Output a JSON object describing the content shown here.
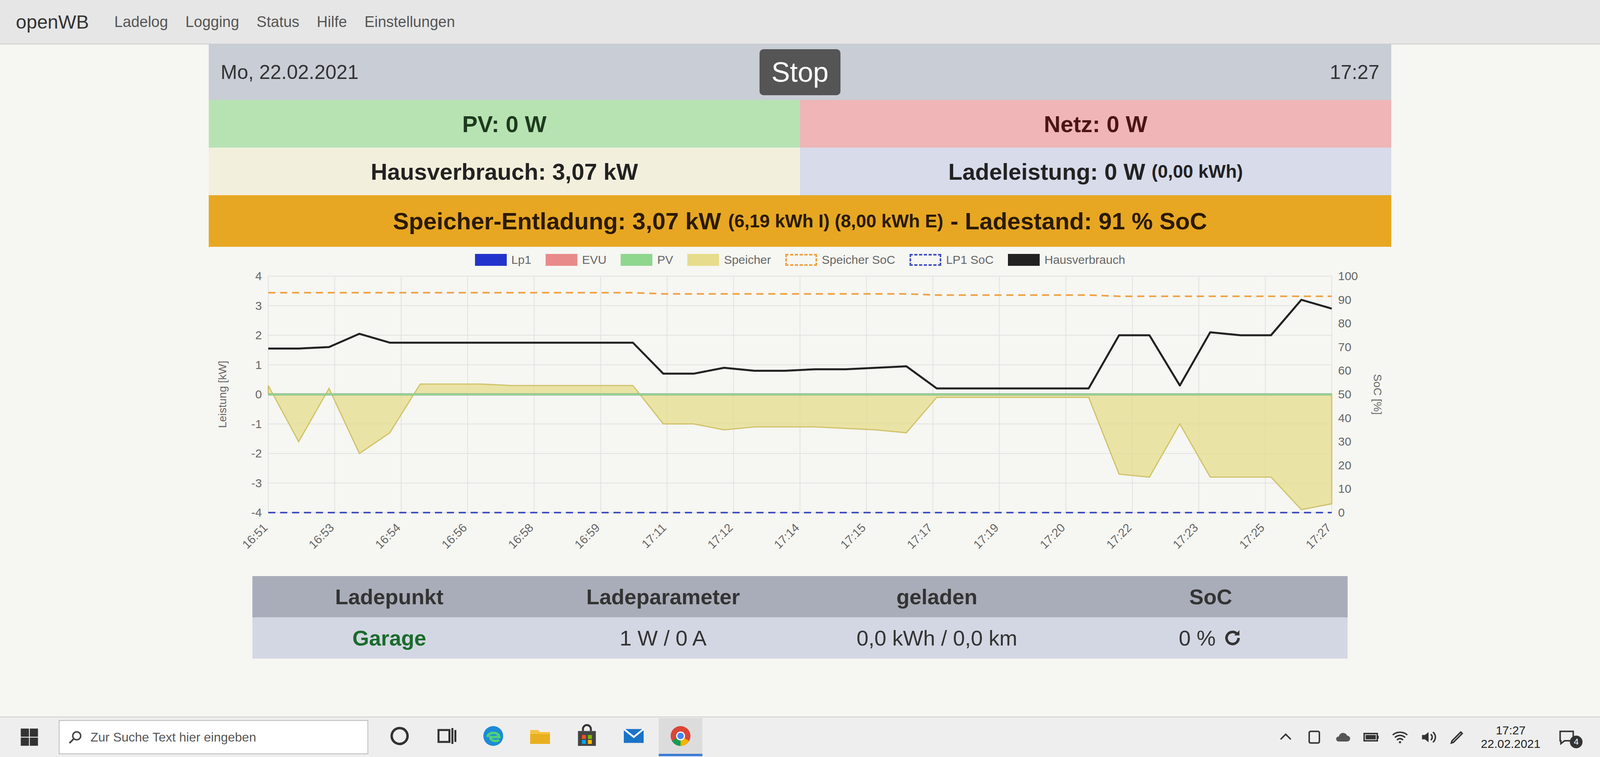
{
  "nav": {
    "brand": "openWB",
    "items": [
      "Ladelog",
      "Logging",
      "Status",
      "Hilfe",
      "Einstellungen"
    ]
  },
  "header": {
    "date": "Mo, 22.02.2021",
    "button": "Stop",
    "time": "17:27"
  },
  "tiles": {
    "pv": "PV: 0 W",
    "netz": "Netz: 0 W",
    "hausverbrauch": "Hausverbrauch: 3,07 kW",
    "ladeleistung": "Ladeleistung: 0 W",
    "ladeleistung_detail": "(0,00 kWh)"
  },
  "speicher": {
    "label": "Speicher-Entladung: 3,07 kW",
    "detail": "(6,19 kWh I) (8,00 kWh E)",
    "soc": "- Ladestand: 91 % SoC"
  },
  "chart": {
    "y_left": {
      "title": "Leistung [kW]",
      "ticks": [
        "4",
        "3",
        "2",
        "1",
        "0",
        "-1",
        "-2",
        "-3",
        "-4"
      ]
    },
    "y_right": {
      "title": "SoC [%]",
      "ticks": [
        "100",
        "90",
        "80",
        "70",
        "60",
        "50",
        "40",
        "30",
        "20",
        "10",
        "0"
      ]
    },
    "x_ticks": [
      "16:51",
      "16:53",
      "16:54",
      "16:56",
      "16:58",
      "16:59",
      "17:11",
      "17:12",
      "17:14",
      "17:15",
      "17:17",
      "17:19",
      "17:20",
      "17:22",
      "17:23",
      "17:25",
      "17:27"
    ],
    "series": [
      {
        "label": "Lp1",
        "color": "#2233cc",
        "kind": "line",
        "axis": "left",
        "values": [
          0,
          0,
          0,
          0,
          0,
          0,
          0,
          0,
          0,
          0,
          0,
          0,
          0,
          0,
          0,
          0,
          0,
          0,
          0,
          0,
          0,
          0,
          0,
          0,
          0,
          0,
          0,
          0,
          0,
          0,
          0,
          0,
          0,
          0,
          0,
          0
        ]
      },
      {
        "label": "EVU",
        "color": "#e88a8a",
        "kind": "line",
        "axis": "left",
        "values": [
          0,
          0,
          0,
          0,
          0,
          0,
          0,
          0,
          0,
          0,
          0,
          0,
          0,
          0,
          0,
          0,
          0,
          0,
          0,
          0,
          0,
          0,
          0,
          0,
          0,
          0,
          0,
          0,
          0,
          0,
          0,
          0,
          0,
          0,
          0,
          0
        ]
      },
      {
        "label": "PV",
        "color": "#8fd68f",
        "kind": "line",
        "axis": "left",
        "values": [
          0,
          0,
          0,
          0,
          0,
          0,
          0,
          0,
          0,
          0,
          0,
          0,
          0,
          0,
          0,
          0,
          0,
          0,
          0,
          0,
          0,
          0,
          0,
          0,
          0,
          0,
          0,
          0,
          0,
          0,
          0,
          0,
          0,
          0,
          0,
          0
        ]
      },
      {
        "label": "Speicher",
        "color": "#e6dc8c",
        "kind": "area",
        "axis": "left",
        "values": [
          0.3,
          -1.6,
          0.2,
          -2.0,
          -1.3,
          0.35,
          0.35,
          0.35,
          0.3,
          0.3,
          0.3,
          0.3,
          0.3,
          -1.0,
          -1.0,
          -1.2,
          -1.1,
          -1.1,
          -1.1,
          -1.15,
          -1.2,
          -1.3,
          -0.1,
          -0.1,
          -0.1,
          -0.1,
          -0.1,
          -0.1,
          -2.7,
          -2.8,
          -1.0,
          -2.8,
          -2.8,
          -2.8,
          -3.9,
          -3.7
        ]
      },
      {
        "label": "Speicher SoC",
        "color": "#f0a040",
        "kind": "dashed",
        "axis": "right",
        "values": [
          93,
          93,
          93,
          93,
          93,
          93,
          93,
          93,
          93,
          93,
          93,
          93,
          93,
          92.5,
          92.5,
          92.5,
          92.5,
          92.5,
          92.5,
          92.5,
          92.5,
          92.5,
          92,
          92,
          92,
          92,
          92,
          92,
          91.5,
          91.5,
          91.5,
          91.5,
          91.5,
          91.5,
          91.5,
          91.5
        ]
      },
      {
        "label": "LP1 SoC",
        "color": "#4050c0",
        "kind": "dashed",
        "axis": "right",
        "values": [
          0,
          0,
          0,
          0,
          0,
          0,
          0,
          0,
          0,
          0,
          0,
          0,
          0,
          0,
          0,
          0,
          0,
          0,
          0,
          0,
          0,
          0,
          0,
          0,
          0,
          0,
          0,
          0,
          0,
          0,
          0,
          0,
          0,
          0,
          0,
          0
        ]
      },
      {
        "label": "Hausverbrauch",
        "color": "#222222",
        "kind": "line",
        "axis": "left",
        "values": [
          1.55,
          1.55,
          1.6,
          2.05,
          1.75,
          1.75,
          1.75,
          1.75,
          1.75,
          1.75,
          1.75,
          1.75,
          1.75,
          0.7,
          0.7,
          0.9,
          0.8,
          0.8,
          0.85,
          0.85,
          0.9,
          0.95,
          0.2,
          0.2,
          0.2,
          0.2,
          0.2,
          0.2,
          2.0,
          2.0,
          0.3,
          2.1,
          2.0,
          2.0,
          3.2,
          2.9
        ]
      }
    ]
  },
  "table": {
    "columns": [
      "Ladepunkt",
      "Ladeparameter",
      "geladen",
      "SoC"
    ],
    "rows": [
      {
        "ladepunkt": "Garage",
        "ladeparameter": "1 W / 0 A",
        "geladen": "0,0 kWh / 0,0 km",
        "soc": "0 %"
      }
    ]
  },
  "taskbar": {
    "search_placeholder": "Zur Suche Text hier eingeben",
    "apps": [
      {
        "kind": "cortana",
        "selected": false
      },
      {
        "kind": "taskview",
        "selected": false
      },
      {
        "kind": "edge",
        "selected": false
      },
      {
        "kind": "explorer",
        "selected": false
      },
      {
        "kind": "store",
        "selected": false
      },
      {
        "kind": "mail",
        "selected": false
      },
      {
        "kind": "chrome",
        "selected": true
      }
    ],
    "clock": {
      "time": "17:27",
      "date": "22.02.2021"
    },
    "notifications": "4"
  }
}
